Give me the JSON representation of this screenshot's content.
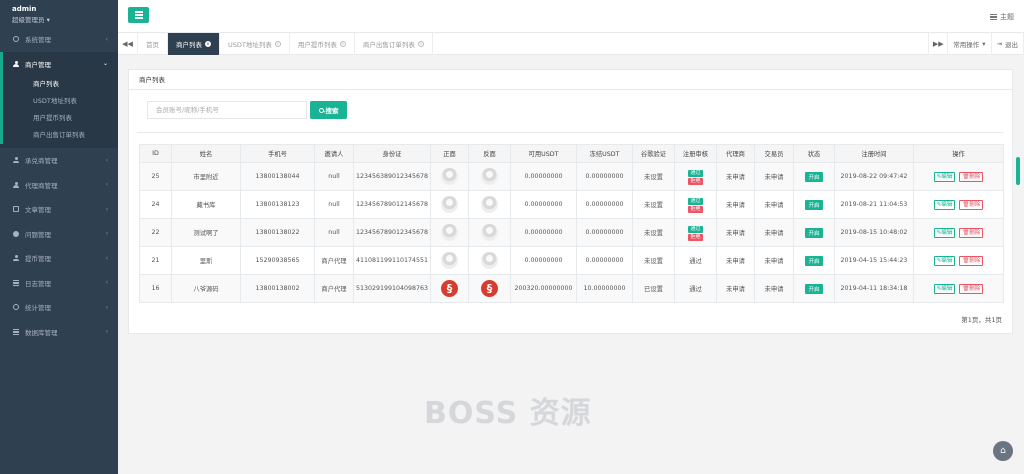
{
  "profile": {
    "name": "admin",
    "role": "超级管理员"
  },
  "sidebar": {
    "items": [
      {
        "label": "系统管理",
        "icon": "gear-icon"
      },
      {
        "label": "商户管理",
        "icon": "user-icon",
        "expanded": true,
        "children": [
          "商户列表",
          "USDT地址列表",
          "用户提币列表",
          "商户出售订单列表"
        ]
      },
      {
        "label": "承兑商管理",
        "icon": "user-icon"
      },
      {
        "label": "代理商管理",
        "icon": "user-icon"
      },
      {
        "label": "文章管理",
        "icon": "doc-icon"
      },
      {
        "label": "问题管理",
        "icon": "chat-icon"
      },
      {
        "label": "提币管理",
        "icon": "user-icon"
      },
      {
        "label": "日志管理",
        "icon": "list-icon"
      },
      {
        "label": "统计管理",
        "icon": "chart-icon"
      },
      {
        "label": "数据库管理",
        "icon": "list-icon"
      }
    ]
  },
  "topbar": {
    "theme_label": "主题"
  },
  "tabs": {
    "home": "首页",
    "items": [
      {
        "label": "商户列表",
        "active": true
      },
      {
        "label": "USDT地址列表",
        "active": false
      },
      {
        "label": "用户提币列表",
        "active": false
      },
      {
        "label": "商户出售订单列表",
        "active": false
      }
    ],
    "common_ops": "常用操作",
    "logout": "退出"
  },
  "panel": {
    "title": "商户列表",
    "search_placeholder": "会员账号/昵称/手机号",
    "search_button": "搜索",
    "page_info": "第1页，共1页"
  },
  "table": {
    "headers": [
      "ID",
      "姓名",
      "手机号",
      "邀请人",
      "身份证",
      "正面",
      "反面",
      "可用USDT",
      "冻结USDT",
      "谷歌验证",
      "注册审核",
      "代理商",
      "交易员",
      "状态",
      "注册时间",
      "操作"
    ],
    "rows": [
      {
        "id": "25",
        "name": "市里附近",
        "phone": "13800138044",
        "inviter": "null",
        "idcard": "123456389012345678",
        "front": "placeholder",
        "back": "placeholder",
        "available": "0.00000000",
        "frozen": "0.00000000",
        "google": "未设置",
        "audit": [
          "通过",
          "拒绝"
        ],
        "agent": "未申请",
        "trader": "未申请",
        "status": "开启",
        "time": "2019-08-22 09:47:42"
      },
      {
        "id": "24",
        "name": "藏书库",
        "phone": "13800138123",
        "inviter": "null",
        "idcard": "123456789012145678",
        "front": "placeholder",
        "back": "placeholder",
        "available": "0.00000000",
        "frozen": "0.00000000",
        "google": "未设置",
        "audit": [
          "通过",
          "拒绝"
        ],
        "agent": "未申请",
        "trader": "未申请",
        "status": "开启",
        "time": "2019-08-21 11:04:53"
      },
      {
        "id": "22",
        "name": "测试啊了",
        "phone": "13800138022",
        "inviter": "null",
        "idcard": "123456789012345678",
        "front": "placeholder",
        "back": "placeholder",
        "available": "0.00000000",
        "frozen": "0.00000000",
        "google": "未设置",
        "audit": [
          "通过",
          "拒绝"
        ],
        "agent": "未申请",
        "trader": "未申请",
        "status": "开启",
        "time": "2019-08-15 10:48:02"
      },
      {
        "id": "21",
        "name": "里斯",
        "phone": "15290938565",
        "inviter": "商户代理",
        "idcard": "411081199110174551",
        "front": "placeholder",
        "back": "placeholder",
        "available": "0.00000000",
        "frozen": "0.00000000",
        "google": "未设置",
        "audit": [
          "通过"
        ],
        "agent": "未申请",
        "trader": "未申请",
        "status": "开启",
        "time": "2019-04-15 15:44:23"
      },
      {
        "id": "16",
        "name": "八爷源码",
        "phone": "13800138002",
        "inviter": "商户代理",
        "idcard": "513029199104098763",
        "front": "logo",
        "back": "logo",
        "available": "200320.00000000",
        "frozen": "10.00000000",
        "google": "已设置",
        "audit": [
          "通过"
        ],
        "agent": "未申请",
        "trader": "未申请",
        "status": "开启",
        "time": "2019-04-11 18:34:18"
      }
    ],
    "edit_label": "编辑",
    "delete_label": "删除"
  },
  "watermark": "BOSS 资源",
  "colors": {
    "accent": "#1ab394",
    "sidebar": "#2f4050",
    "danger": "#ed5565"
  }
}
